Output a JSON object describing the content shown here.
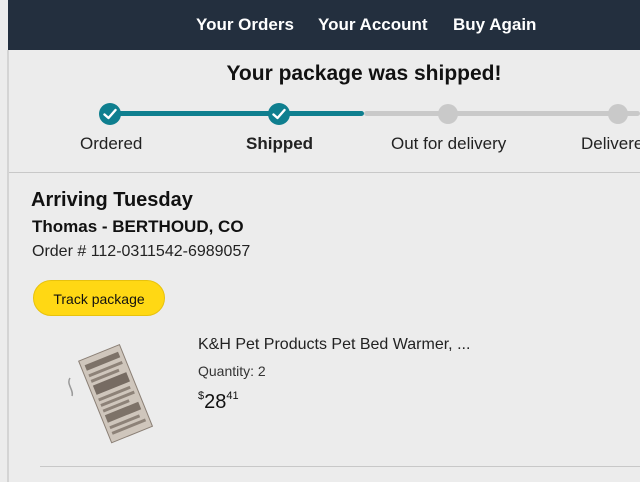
{
  "nav": {
    "items": [
      "Your Orders",
      "Your Account",
      "Buy Again"
    ]
  },
  "status": {
    "headline": "Your package was shipped!",
    "steps": [
      {
        "label": "Ordered",
        "done": true
      },
      {
        "label": "Shipped",
        "done": true,
        "current": true
      },
      {
        "label": "Out for delivery",
        "done": false
      },
      {
        "label": "Delivered",
        "done": false
      }
    ],
    "progress_fraction": 0.5
  },
  "shipment": {
    "arriving": "Arriving Tuesday",
    "ship_to": "Thomas - BERTHOUD, CO",
    "order_number": "Order # 112-0311542-6989057",
    "track_button": "Track package"
  },
  "item": {
    "title": "K&H Pet Products Pet Bed Warmer, ...",
    "quantity": "Quantity: 2",
    "price_symbol": "$",
    "price_whole": "28",
    "price_fraction": "41"
  },
  "colors": {
    "nav_bg": "#232f3e",
    "progress_done": "#0f7f8f",
    "progress_todo": "#c9c9c9",
    "button": "#ffd814"
  }
}
